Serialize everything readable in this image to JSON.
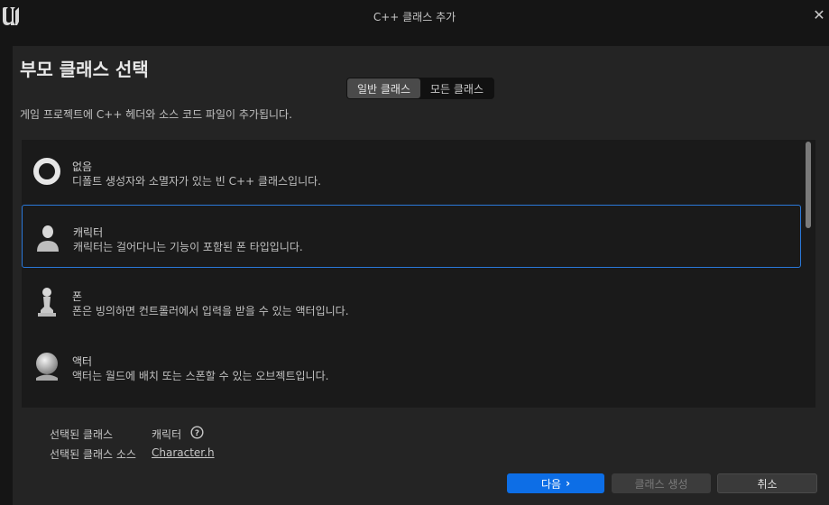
{
  "window": {
    "title": "C++ 클래스 추가"
  },
  "page": {
    "heading": "부모 클래스 선택",
    "description": "게임 프로젝트에 C++ 헤더와 소스 코드 파일이 추가됩니다."
  },
  "tabs": [
    {
      "label": "일반 클래스",
      "active": true
    },
    {
      "label": "모든 클래스",
      "active": false
    }
  ],
  "classes": [
    {
      "name": "없음",
      "description": "디폴트 생성자와 소멸자가 있는 빈 C++ 클래스입니다.",
      "icon": "ring-icon",
      "selected": false
    },
    {
      "name": "캐릭터",
      "description": "캐릭터는 걸어다니는 기능이 포함된 폰 타입입니다.",
      "icon": "character-icon",
      "selected": true
    },
    {
      "name": "폰",
      "description": "폰은 빙의하면 컨트롤러에서 입력을 받을 수 있는 액터입니다.",
      "icon": "pawn-icon",
      "selected": false
    },
    {
      "name": "액터",
      "description": "액터는 월드에 배치 또는 스폰할 수 있는 오브젝트입니다.",
      "icon": "actor-sphere-icon",
      "selected": false
    }
  ],
  "selection": {
    "class_label": "선택된 클래스",
    "class_value": "캐릭터",
    "source_label": "선택된 클래스 소스",
    "source_value": "Character.h"
  },
  "buttons": {
    "next": "다음",
    "create": "클래스 생성",
    "cancel": "취소"
  },
  "colors": {
    "accent": "#0d6ee6",
    "selection_border": "#2a78d8"
  }
}
